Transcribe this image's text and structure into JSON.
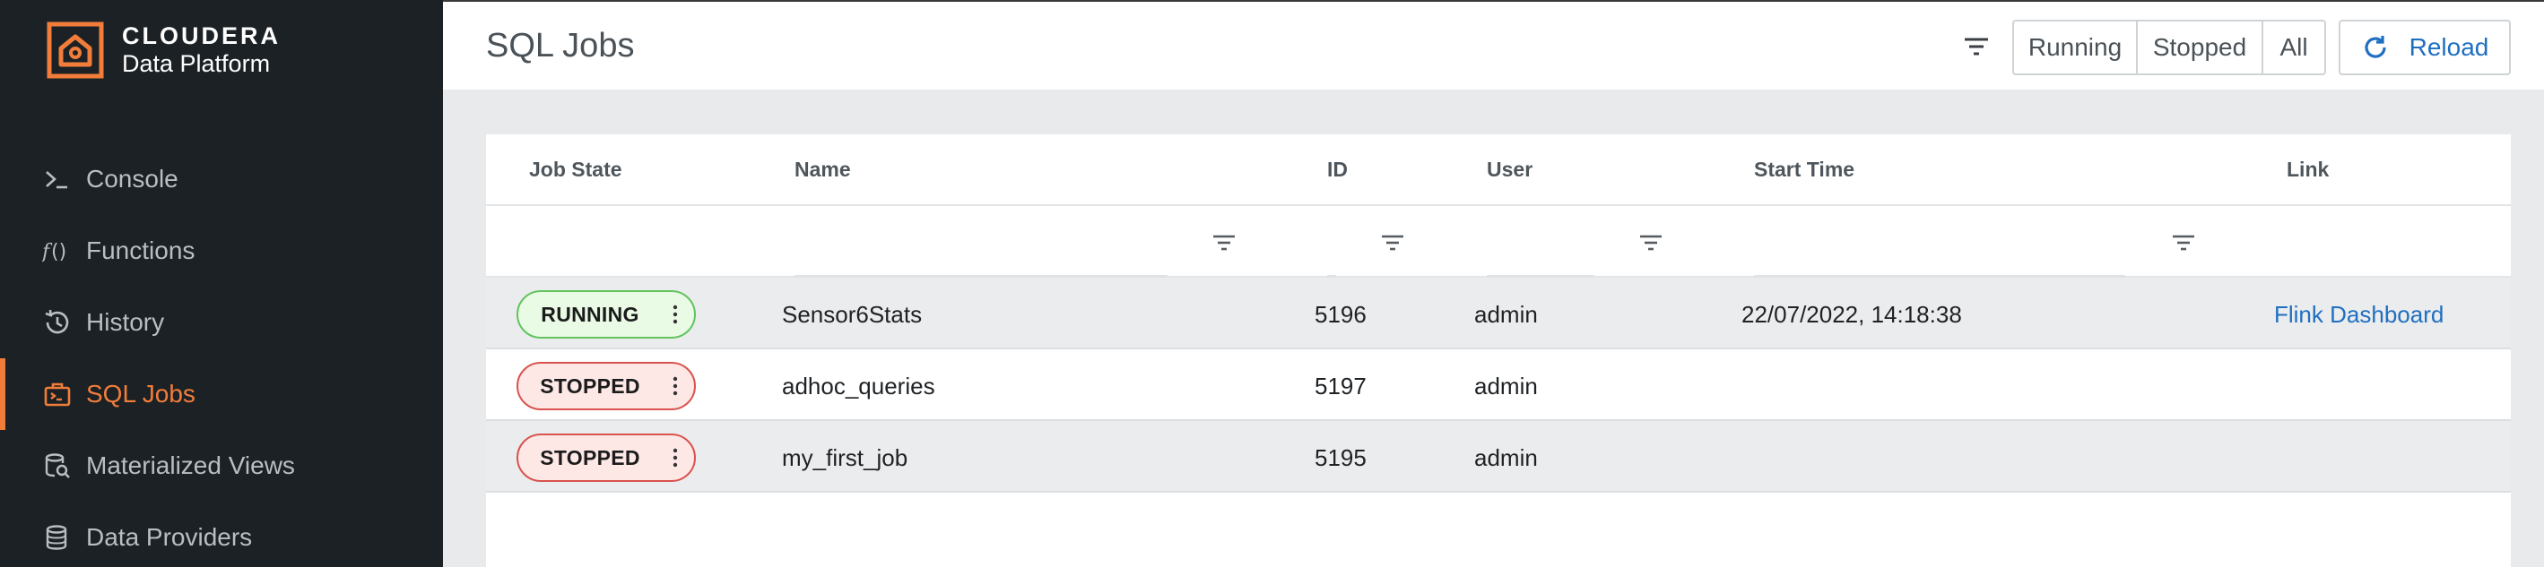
{
  "brand": {
    "name": "CLOUDERA",
    "subtitle": "Data Platform"
  },
  "nav": {
    "items": [
      {
        "label": "Console",
        "icon": "console-icon",
        "active": false
      },
      {
        "label": "Functions",
        "icon": "function-icon",
        "active": false
      },
      {
        "label": "History",
        "icon": "history-icon",
        "active": false
      },
      {
        "label": "SQL Jobs",
        "icon": "sql-jobs-icon",
        "active": true
      },
      {
        "label": "Materialized Views",
        "icon": "materialized-views-icon",
        "active": false
      },
      {
        "label": "Data Providers",
        "icon": "data-providers-icon",
        "active": false
      }
    ]
  },
  "header": {
    "title": "SQL Jobs",
    "filter_icon": "filter-icon",
    "segments": [
      "Running",
      "Stopped",
      "All"
    ],
    "reload_label": "Reload",
    "reload_icon": "refresh-icon"
  },
  "table": {
    "columns": [
      "Job State",
      "Name",
      "ID",
      "User",
      "Start Time",
      "Link"
    ],
    "rows": [
      {
        "state": "RUNNING",
        "name": "Sensor6Stats",
        "id": "5196",
        "user": "admin",
        "start_time": "22/07/2022, 14:18:38",
        "link": "Flink Dashboard"
      },
      {
        "state": "STOPPED",
        "name": "adhoc_queries",
        "id": "5197",
        "user": "admin",
        "start_time": "",
        "link": ""
      },
      {
        "state": "STOPPED",
        "name": "my_first_job",
        "id": "5195",
        "user": "admin",
        "start_time": "",
        "link": ""
      }
    ]
  },
  "colors": {
    "brand_orange": "#f27d3a",
    "sidebar_bg": "#1b2125",
    "link_blue": "#1f6fc1",
    "running_border": "#62c35f",
    "stopped_border": "#d9534f"
  }
}
